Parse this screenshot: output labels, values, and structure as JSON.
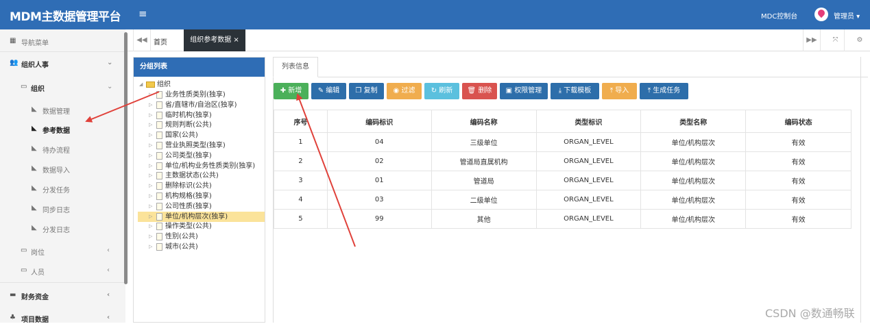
{
  "app": {
    "title": "MDM主数据管理平台",
    "console_link": "MDC控制台",
    "user": "管理员"
  },
  "sidebar": {
    "header": "导航菜单",
    "sections": [
      {
        "label": "组织人事"
      },
      {
        "label": "财务资金"
      },
      {
        "label": "项目数据"
      }
    ],
    "groups": [
      {
        "label": "组织"
      },
      {
        "label": "岗位"
      },
      {
        "label": "人员"
      }
    ],
    "items": [
      {
        "label": "数据管理"
      },
      {
        "label": "参考数据"
      },
      {
        "label": "待办流程"
      },
      {
        "label": "数据导入"
      },
      {
        "label": "分发任务"
      },
      {
        "label": "同步日志"
      },
      {
        "label": "分发日志"
      }
    ]
  },
  "tabs": {
    "home": "首页",
    "active": "组织参考数据"
  },
  "group_panel": {
    "title": "分组列表",
    "root": "组织",
    "items": [
      "业务性质类别(独享)",
      "省/直辖市/自治区(独享)",
      "临时机构(独享)",
      "规则判断(公共)",
      "国家(公共)",
      "营业执照类型(独享)",
      "公司类型(独享)",
      "单位/机构业务性质类别(独享)",
      "主数据状态(公共)",
      "删除标识(公共)",
      "机构规格(独享)",
      "公司性质(独享)",
      "单位/机构层次(独享)",
      "操作类型(公共)",
      "性别(公共)",
      "城市(公共)"
    ],
    "selected_index": 12
  },
  "main": {
    "tab_label": "列表信息",
    "toolbar": {
      "add": "新增",
      "edit": "编辑",
      "copy": "复制",
      "filter": "过滤",
      "refresh": "刷新",
      "delete": "删除",
      "permissions": "权限管理",
      "download_template": "下载模板",
      "import": "导入",
      "generate_task": "生成任务"
    },
    "columns": [
      "序号",
      "编码标识",
      "编码名称",
      "类型标识",
      "类型名称",
      "编码状态"
    ],
    "rows": [
      [
        "1",
        "04",
        "三级单位",
        "ORGAN_LEVEL",
        "单位/机构层次",
        "有效"
      ],
      [
        "2",
        "02",
        "管道局直属机构",
        "ORGAN_LEVEL",
        "单位/机构层次",
        "有效"
      ],
      [
        "3",
        "01",
        "管道局",
        "ORGAN_LEVEL",
        "单位/机构层次",
        "有效"
      ],
      [
        "4",
        "03",
        "二级单位",
        "ORGAN_LEVEL",
        "单位/机构层次",
        "有效"
      ],
      [
        "5",
        "99",
        "其他",
        "ORGAN_LEVEL",
        "单位/机构层次",
        "有效"
      ]
    ]
  },
  "watermark": "CSDN @数通畅联",
  "colors": {
    "topbar": "#2f6db5",
    "add": "#4bb05a",
    "edit": "#2d6eaa",
    "filter": "#f0ad4e",
    "refresh": "#5bc0de",
    "delete": "#d9534f",
    "annotation_arrow": "#e0413a"
  }
}
